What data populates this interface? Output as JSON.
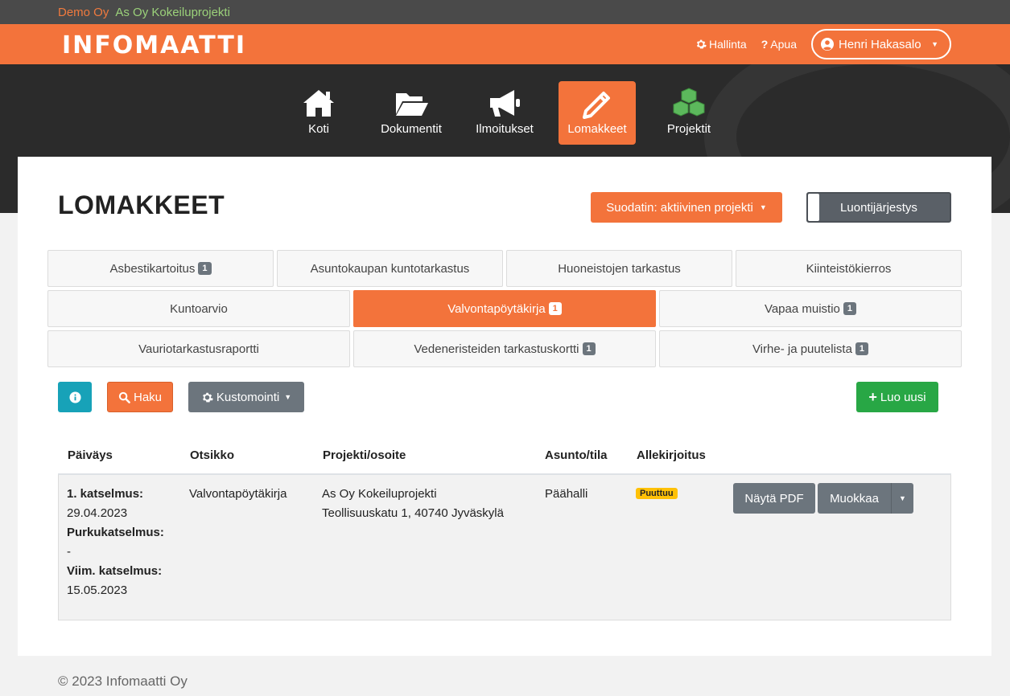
{
  "topbar": {
    "organization": "Demo Oy",
    "project": "As Oy Kokeiluprojekti"
  },
  "navbar": {
    "logo": "INFOMAATTI",
    "admin_label": "Hallinta",
    "help_label": "Apua",
    "user_name": "Henri Hakasalo"
  },
  "main_nav": [
    {
      "label": "Koti",
      "icon": "home-icon"
    },
    {
      "label": "Dokumentit",
      "icon": "folder-open-icon"
    },
    {
      "label": "Ilmoitukset",
      "icon": "megaphone-icon"
    },
    {
      "label": "Lomakkeet",
      "icon": "pencil-icon",
      "active": true
    },
    {
      "label": "Projektit",
      "icon": "cubes-icon"
    }
  ],
  "page": {
    "title": "LOMAKKEET",
    "filter_label": "Suodatin: aktiivinen projekti",
    "sort_label": "Luontijärjestys"
  },
  "tabs": [
    {
      "label": "Asbestikartoitus",
      "badge": "1"
    },
    {
      "label": "Asuntokaupan kuntotarkastus"
    },
    {
      "label": "Huoneistojen tarkastus"
    },
    {
      "label": "Kiinteistökierros"
    },
    {
      "label": "Kuntoarvio"
    },
    {
      "label": "Valvontapöytäkirja",
      "badge": "1",
      "active": true
    },
    {
      "label": "Vapaa muistio",
      "badge": "1"
    },
    {
      "label": "Vauriotarkastusraportti"
    },
    {
      "label": "Vedeneristeiden tarkastuskortti",
      "badge": "1"
    },
    {
      "label": "Virhe- ja puutelista",
      "badge": "1"
    }
  ],
  "toolbar": {
    "search_label": "Haku",
    "customize_label": "Kustomointi",
    "create_label": "Luo uusi"
  },
  "table": {
    "columns": [
      "Päiväys",
      "Otsikko",
      "Projekti/osoite",
      "Asunto/tila",
      "Allekirjoitus"
    ],
    "rows": [
      {
        "first_label": "1. katselmus:",
        "first_date": "29.04.2023",
        "demo_label": "Purkukatselmus:",
        "demo_date": "-",
        "last_label": "Viim. katselmus:",
        "last_date": "15.05.2023",
        "title": "Valvontapöytäkirja",
        "project": "As Oy Kokeiluprojekti",
        "address": "Teollisuuskatu 1, 40740 Jyväskylä",
        "space": "Päähalli",
        "signature_status": "Puuttuu",
        "pdf_label": "Näytä PDF",
        "edit_label": "Muokkaa"
      }
    ]
  },
  "footer": {
    "copyright": "© 2023 Infomaatti Oy"
  },
  "colors": {
    "brand": "#f3733b",
    "dark": "#2b2b2b",
    "success": "#28a745",
    "info": "#17a2b8",
    "warning": "#ffc107"
  }
}
